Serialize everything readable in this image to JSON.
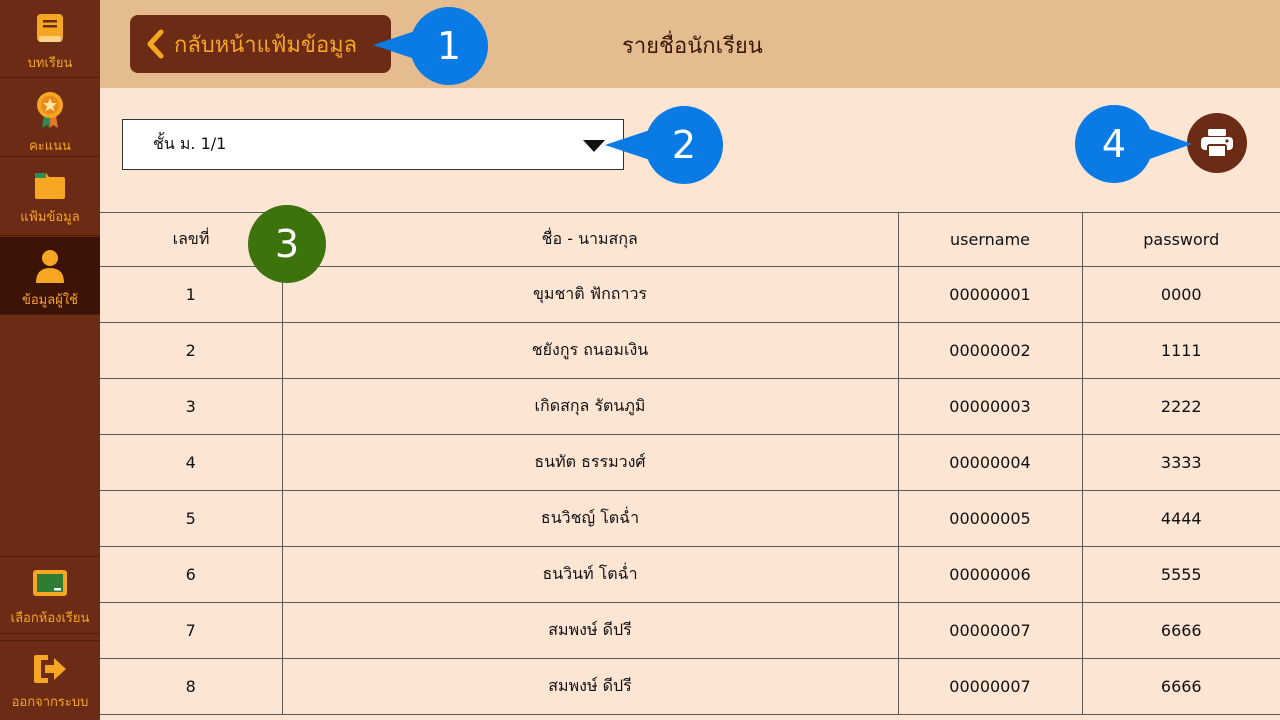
{
  "sidebar": {
    "items": [
      {
        "label": "บทเรียน",
        "icon": "book-icon"
      },
      {
        "label": "คะแนน",
        "icon": "medal-icon"
      },
      {
        "label": "แฟ้มข้อมูล",
        "icon": "folder-icon"
      },
      {
        "label": "ข้อมูลผู้ใช้",
        "icon": "user-icon",
        "active": true
      },
      {
        "label": "เลือกห้องเรียน",
        "icon": "classroom-icon"
      },
      {
        "label": "ออกจากระบบ",
        "icon": "logout-icon"
      }
    ]
  },
  "header": {
    "back_label": "กลับหน้าแฟ้มข้อมูล",
    "title": "รายชื่อนักเรียน"
  },
  "class_select": {
    "value": "ชั้น ม. 1/1"
  },
  "callouts": [
    "1",
    "2",
    "3",
    "4"
  ],
  "table": {
    "headers": [
      "เลขที่",
      "ชื่อ - นามสกุล",
      "username",
      "password"
    ],
    "rows": [
      {
        "no": "1",
        "name": "ขุมชาติ ฟักถาวร",
        "username": "00000001",
        "password": "0000"
      },
      {
        "no": "2",
        "name": "ชยังกูร ถนอมเงิน",
        "username": "00000002",
        "password": "1111"
      },
      {
        "no": "3",
        "name": "เกิดสกุล รัตนภูมิ",
        "username": "00000003",
        "password": "2222"
      },
      {
        "no": "4",
        "name": "ธนทัต ธรรมวงศ์",
        "username": "00000004",
        "password": "3333"
      },
      {
        "no": "5",
        "name": "ธนวิชญ์ โตฉ่ำ",
        "username": "00000005",
        "password": "4444"
      },
      {
        "no": "6",
        "name": "ธนวินท์ โตฉ่ำ",
        "username": "00000006",
        "password": "5555"
      },
      {
        "no": "7",
        "name": "สมพงษ์ ดีปรี",
        "username": "00000007",
        "password": "6666"
      },
      {
        "no": "8",
        "name": "สมพงษ์ ดีปรี",
        "username": "00000007",
        "password": "6666"
      }
    ]
  },
  "colors": {
    "sidebar": "#6b2b14",
    "sidebar_active": "#3d1207",
    "accent": "#f6a623",
    "header": "#e5bb90",
    "background": "#fde5d4",
    "callout_blue": "#0a7ae4",
    "callout_green": "#3c730c"
  }
}
